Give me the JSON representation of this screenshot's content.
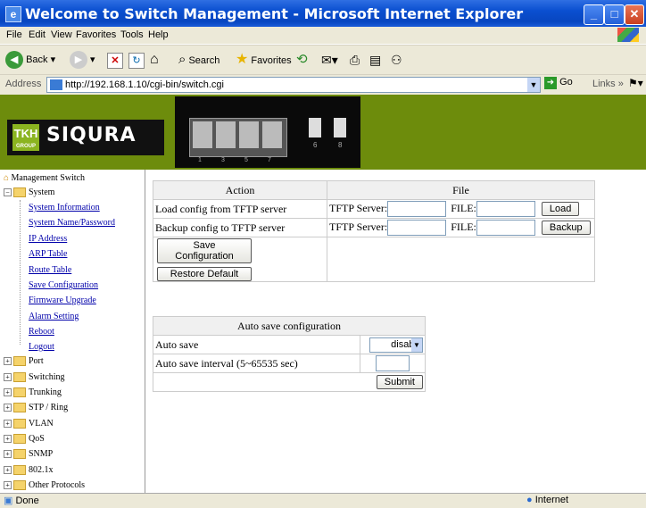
{
  "window": {
    "title": "Welcome to Switch Management - Microsoft Internet Explorer",
    "app_icon": "ie-icon"
  },
  "menu": [
    "File",
    "Edit",
    "View",
    "Favorites",
    "Tools",
    "Help"
  ],
  "toolbar": {
    "back": "Back",
    "search": "Search",
    "favorites": "Favorites"
  },
  "address": {
    "label": "Address",
    "url": "http://192.168.1.10/cgi-bin/switch.cgi",
    "go": "Go",
    "links": "Links"
  },
  "banner": {
    "brand": "SIQURA",
    "tkh": "TKH",
    "group": "GROUP",
    "port_labels": [
      "1",
      "3",
      "5",
      "7",
      "6",
      "8"
    ]
  },
  "sidebar": {
    "root": "Management Switch",
    "system": "System",
    "system_items": [
      "System Information",
      "System Name/Password",
      "IP Address",
      "ARP Table",
      "Route Table",
      "Save Configuration",
      "Firmware Upgrade",
      "Alarm Setting",
      "Reboot",
      "Logout"
    ],
    "folders": [
      "Port",
      "Switching",
      "Trunking",
      "STP / Ring",
      "VLAN",
      "QoS",
      "SNMP",
      "802.1x",
      "Other Protocols"
    ]
  },
  "config_table": {
    "headers": [
      "Action",
      "File"
    ],
    "load_label": "Load config from TFTP server",
    "backup_label": "Backup config to TFTP server",
    "tftp_label": "TFTP Server:",
    "file_label": "FILE:",
    "load_button": "Load",
    "backup_button": "Backup",
    "save_button": "Save Configuration",
    "restore_button": "Restore Default"
  },
  "autosave": {
    "header": "Auto save configuration",
    "auto_save_label": "Auto save",
    "auto_save_value": "disable",
    "interval_label": "Auto save interval (5~65535 sec)",
    "submit": "Submit"
  },
  "status": {
    "left": "Done",
    "zone": "Internet"
  }
}
